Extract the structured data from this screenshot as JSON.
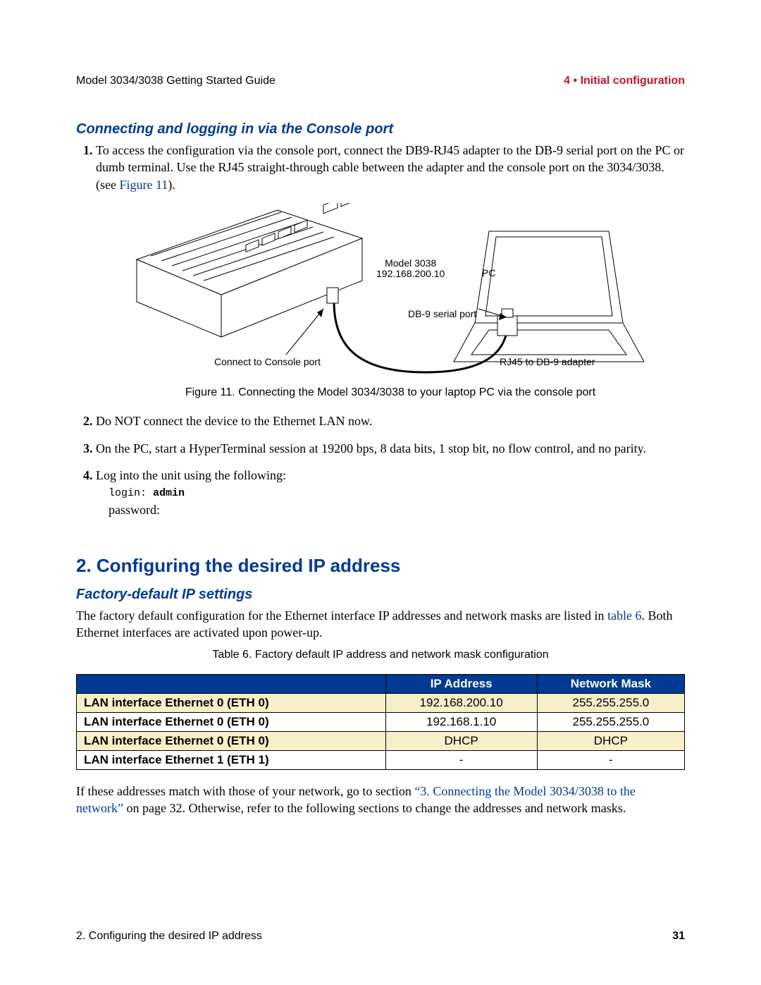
{
  "header": {
    "left": "Model 3034/3038 Getting Started Guide",
    "right": "4 • Initial configuration"
  },
  "section1": {
    "subheading": "Connecting and logging in via the Console port",
    "steps": {
      "s1a": "To access the  configuration via the console port, connect the DB9-RJ45 adapter to the DB-9 serial port on the PC or dumb terminal. Use the RJ45 straight-through cable between the adapter and the console port on the 3034/3038. (see ",
      "s1link": "Figure 11",
      "s1b": ").",
      "s2": "Do NOT connect the device to the Ethernet LAN now.",
      "s3": "On the PC, start a HyperTerminal session at 19200 bps, 8 data bits, 1 stop bit, no flow control, and no parity.",
      "s4": "Log into the unit using the following:"
    },
    "login_label": "login: ",
    "login_value": "admin",
    "password_label": "password:"
  },
  "figure": {
    "caption": "Figure 11. Connecting the Model 3034/3038 to your laptop PC via the console port",
    "labels": {
      "model": "Model 3038",
      "ip": "192.168.200.10",
      "pc": "PC",
      "db9": "DB-9 serial port",
      "console": "Connect to Console port",
      "adapter": "RJ45 to DB-9 adapter"
    }
  },
  "section2": {
    "heading": "2. Configuring the desired IP address",
    "subheading": "Factory-default IP settings",
    "p1a": "The factory default configuration for the Ethernet interface IP addresses and network masks are listed in ",
    "p1link": "table 6",
    "p1b": ". Both Ethernet interfaces are activated upon power-up.",
    "table_caption": "Table 6. Factory default IP address and network mask configuration",
    "p2a": "If these addresses match with those of your network, go to section ",
    "p2link": "“3. Connecting the Model 3034/3038 to the network”",
    "p2b": " on page 32. Otherwise, refer to the following sections to change the addresses and network masks."
  },
  "table": {
    "headers": {
      "c0": "",
      "c1": "IP Address",
      "c2": "Network Mask"
    },
    "rows": [
      {
        "c0": "LAN interface Ethernet 0 (ETH 0)",
        "c1": "192.168.200.10",
        "c2": "255.255.255.0"
      },
      {
        "c0": "LAN interface Ethernet 0 (ETH 0)",
        "c1": "192.168.1.10",
        "c2": "255.255.255.0"
      },
      {
        "c0": "LAN interface Ethernet 0 (ETH 0)",
        "c1": "DHCP",
        "c2": "DHCP"
      },
      {
        "c0": "LAN interface Ethernet 1 (ETH 1)",
        "c1": "-",
        "c2": "-"
      }
    ]
  },
  "footer": {
    "left": "2. Configuring the desired IP address",
    "right": "31"
  }
}
